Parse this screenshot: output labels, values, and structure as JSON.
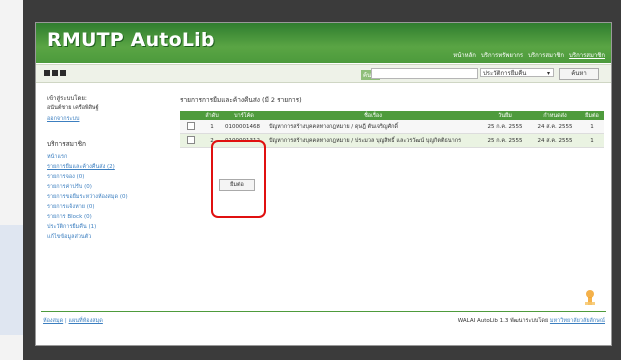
{
  "app": {
    "title": "RMUTP AutoLib"
  },
  "topnav": [
    {
      "label": "หน้าหลัก",
      "active": false
    },
    {
      "label": "บริการทรัพยากร",
      "active": false
    },
    {
      "label": "บริการสมาชิก",
      "active": false
    },
    {
      "label": "บริการสมาชิก",
      "active": true
    }
  ],
  "search": {
    "label": "ค้นหา",
    "value": "",
    "scope": "ประวัติการยืมคืน",
    "button": "ค้นหา"
  },
  "sidebar": {
    "login_label": "เข้าสู่ระบบโดย:",
    "user_name": "อนันต์ชาย เครือพิสิษฐ์",
    "logout": "ออกจากระบบ",
    "section_title": "บริการสมาชิก",
    "items": [
      {
        "label": "หน้าแรก"
      },
      {
        "label": "รายการยืมและค้างคืนส่ง (2)"
      },
      {
        "label": "รายการจอง (0)"
      },
      {
        "label": "รายการค่าปรับ (0)"
      },
      {
        "label": "รายการขอยืมระหว่างห้องสมุด (0)"
      },
      {
        "label": "รายการแจ้งหาย (0)"
      },
      {
        "label": "รายการ Block (0)"
      },
      {
        "label": "ประวัติการยืมคืน (1)"
      },
      {
        "label": "แก้ไขข้อมูลส่วนตัว"
      }
    ]
  },
  "main": {
    "title": "รายการการยืมและค้างคืนส่ง (มี 2 รายการ)",
    "columns": [
      "",
      "ลำดับ",
      "บาร์โค้ด",
      "ชื่อเรื่อง",
      "วันยืม",
      "กำหนดส่ง",
      "ยืมต่อ"
    ],
    "rows": [
      {
        "no": "1",
        "barcode": "0100001468",
        "title": "ปัญหาการสร้างบุคคลทางกฎหมาย / ดุษฎี ตันเจริญศักดิ์",
        "loan_date": "25 ก.ค. 2555",
        "due_date": "24 ส.ค. 2555",
        "renew_count": "1"
      },
      {
        "no": "2",
        "barcode": "0100001312",
        "title": "ปัญหาการสร้างบุคคลทางกฎหมาย / ประมวล บุญสิทธิ์ และวรวัฒน์ บุญกิตติธนากร",
        "loan_date": "25 ก.ค. 2555",
        "due_date": "24 ส.ค. 2555",
        "renew_count": "1"
      }
    ],
    "renew_button": "ยืมต่อ"
  },
  "footer": {
    "left_a": "ห้องสมุด",
    "left_b": "แผนที่ห้องสมุด",
    "right_text": "WALAI AutoLib 1.3 พัฒนาระบบโดย",
    "right_link": "มหาวิทยาลัยวลัยลักษณ์"
  }
}
